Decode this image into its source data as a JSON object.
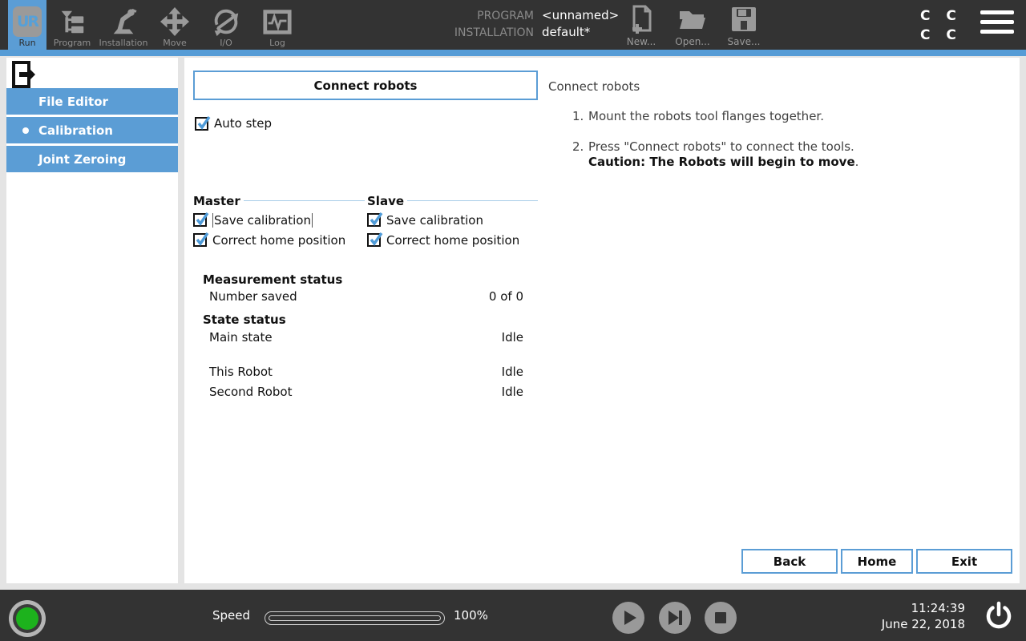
{
  "colors": {
    "accent": "#5b9dd5",
    "bar_bg": "#333333",
    "page_bg": "#e4e4e4",
    "status_green": "#1db21d",
    "icon_gray": "#9a9a9a"
  },
  "header": {
    "tabs": [
      {
        "label": "Run",
        "active": true
      },
      {
        "label": "Program",
        "active": false
      },
      {
        "label": "Installation",
        "active": false
      },
      {
        "label": "Move",
        "active": false
      },
      {
        "label": "I/O",
        "active": false
      },
      {
        "label": "Log",
        "active": false
      }
    ],
    "logo_text": "UR",
    "program_label": "PROGRAM",
    "program_value": "<unnamed>",
    "installation_label": "INSTALLATION",
    "installation_value": "default*",
    "file_buttons": [
      {
        "label": "New..."
      },
      {
        "label": "Open..."
      },
      {
        "label": "Save..."
      }
    ],
    "corner": {
      "line1": "C C",
      "line2": "C C"
    }
  },
  "sidebar": {
    "items": [
      {
        "label": "File Editor",
        "active": false
      },
      {
        "label": "Calibration",
        "active": true
      },
      {
        "label": "Joint Zeroing",
        "active": false
      }
    ]
  },
  "main": {
    "connect_button_label": "Connect robots",
    "auto_step_label": "Auto step",
    "groups": [
      {
        "title": "Master",
        "items": [
          "Save calibration",
          "Correct home position"
        ]
      },
      {
        "title": "Slave",
        "items": [
          "Save calibration",
          "Correct home position"
        ]
      }
    ],
    "measurement": {
      "title": "Measurement status",
      "rows": [
        {
          "label": "Number saved",
          "value": "0 of 0"
        }
      ]
    },
    "state": {
      "title": "State status",
      "rows": [
        {
          "label": "Main state",
          "value": "Idle"
        },
        {
          "label": "This Robot",
          "value": "Idle"
        },
        {
          "label": "Second Robot",
          "value": "Idle"
        }
      ]
    },
    "instructions": {
      "title": "Connect robots",
      "steps": [
        {
          "num": "1.",
          "text": "Mount the robots tool flanges together."
        },
        {
          "num": "2.",
          "text": "Press \"Connect robots\" to connect the tools.",
          "caution": "Caution: The Robots will begin to move",
          "caution_tail": "."
        }
      ]
    },
    "nav_buttons": [
      "Back",
      "Home",
      "Exit"
    ]
  },
  "footer": {
    "speed_label": "Speed",
    "speed_value": "100%",
    "time": "11:24:39",
    "date": "June 22, 2018"
  }
}
